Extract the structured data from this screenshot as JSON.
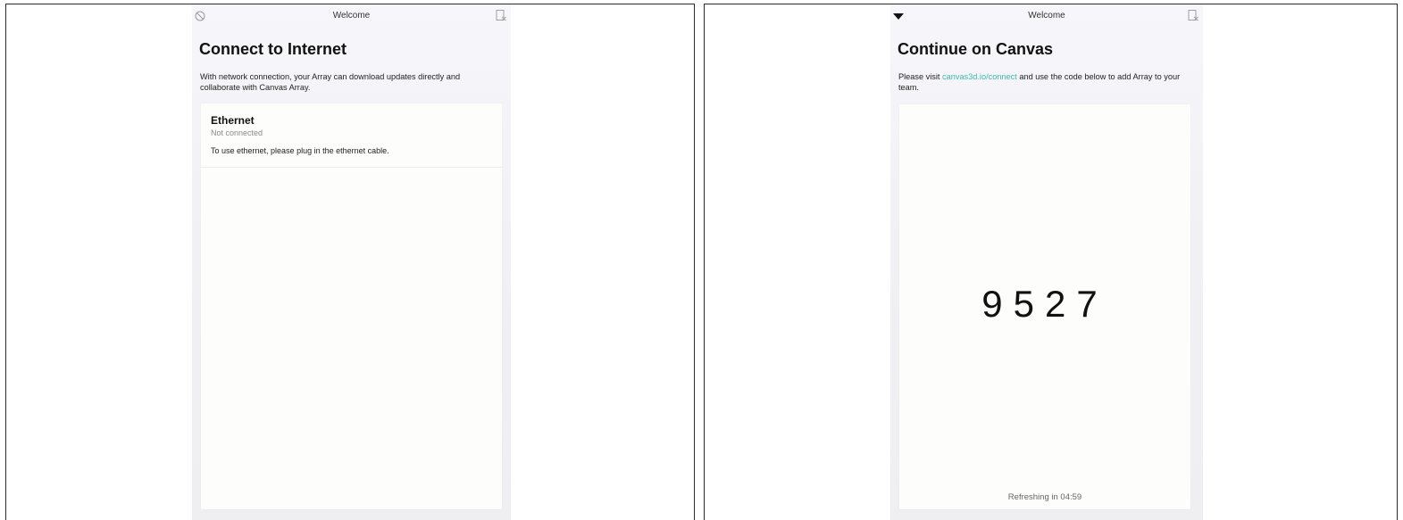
{
  "left_screen": {
    "status_title": "Welcome",
    "heading": "Connect to Internet",
    "description": "With network connection, your Array can download updates directly and collaborate with Canvas Array.",
    "ethernet": {
      "title": "Ethernet",
      "status": "Not connected",
      "hint": "To use ethernet, please plug in the ethernet cable."
    },
    "icons": {
      "status_left": "no-network-icon",
      "status_right": "exit-icon"
    }
  },
  "right_screen": {
    "status_title": "Welcome",
    "heading": "Continue on Canvas",
    "description_prefix": "Please visit ",
    "description_link": "canvas3d.io/connect",
    "description_suffix": " and use the code below to add Array to your team.",
    "code": "9527",
    "refresh": "Refreshing in 04:59",
    "icons": {
      "status_left": "wifi-icon",
      "status_right": "exit-icon"
    }
  },
  "colors": {
    "link": "#3fb6ad",
    "background": "#f1f1f5",
    "card": "#fdfdfc"
  }
}
